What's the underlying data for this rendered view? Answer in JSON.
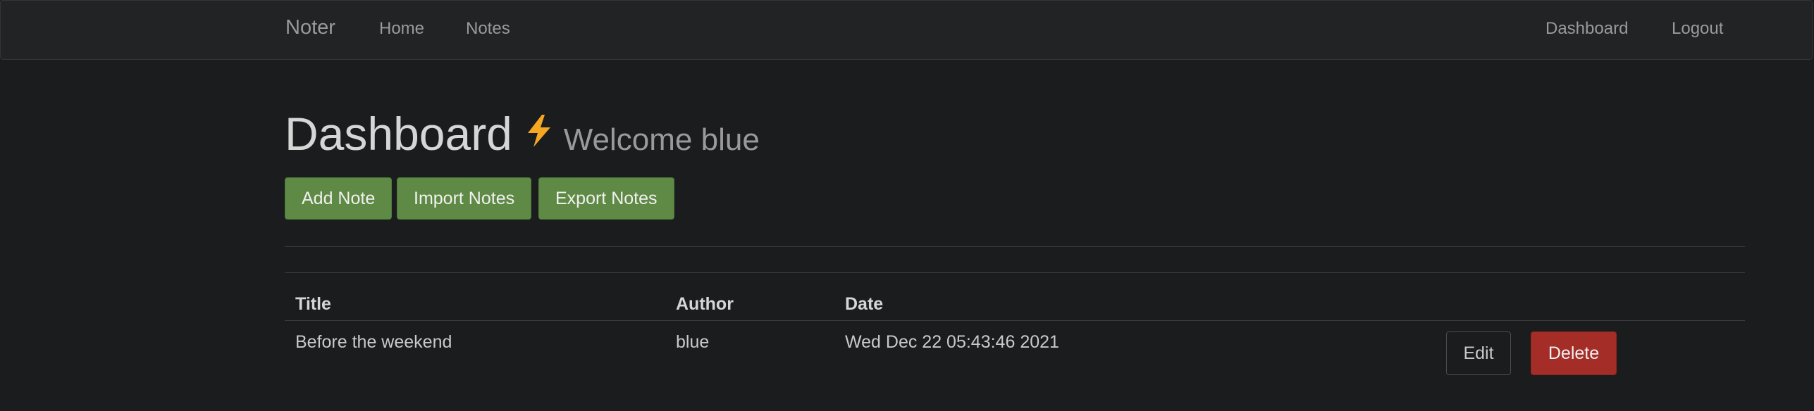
{
  "navbar": {
    "brand": "Noter",
    "links": [
      {
        "label": "Home"
      },
      {
        "label": "Notes"
      }
    ],
    "right_links": [
      {
        "label": "Dashboard"
      },
      {
        "label": "Logout"
      }
    ]
  },
  "page": {
    "title": "Dashboard",
    "bolt_icon": "lightning-bolt-icon",
    "welcome": "Welcome blue"
  },
  "actions": {
    "add_note": "Add Note",
    "import_notes": "Import Notes",
    "export_notes": "Export Notes"
  },
  "table": {
    "headers": [
      "Title",
      "Author",
      "Date"
    ],
    "rows": [
      {
        "title": "Before the weekend",
        "author": "blue",
        "date": "Wed Dec 22 05:43:46 2021",
        "edit_label": "Edit",
        "delete_label": "Delete"
      }
    ]
  },
  "colors": {
    "background": "#1b1c1e",
    "navbar": "#222325",
    "success": "#5f8a45",
    "danger": "#a52d27",
    "bolt": "#f5a623"
  }
}
